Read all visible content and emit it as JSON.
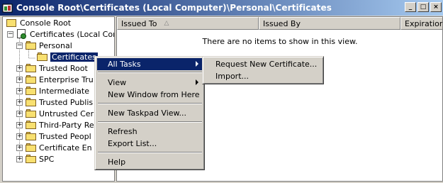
{
  "window": {
    "title": "Console Root\\Certificates (Local Computer)\\Personal\\Certificates",
    "buttons": [
      "_",
      "□",
      "×"
    ]
  },
  "tree": {
    "items": [
      {
        "label": "Console Root",
        "icon": "console-root-icon"
      },
      {
        "label": "Certificates (Local Com",
        "icon": "certificate-snapin-icon",
        "expander": "−"
      },
      {
        "label": "Personal",
        "icon": "folder-icon",
        "expander": "−"
      },
      {
        "label": "Certificates",
        "icon": "folder-open-icon"
      },
      {
        "label": "Trusted Root",
        "icon": "folder-icon",
        "expander": "+"
      },
      {
        "label": "Enterprise Tru",
        "icon": "folder-icon",
        "expander": "+"
      },
      {
        "label": "Intermediate",
        "icon": "folder-icon",
        "expander": "+"
      },
      {
        "label": "Trusted Publis",
        "icon": "folder-icon",
        "expander": "+"
      },
      {
        "label": "Untrusted Cer",
        "icon": "folder-icon",
        "expander": "+"
      },
      {
        "label": "Third-Party Re",
        "icon": "folder-icon",
        "expander": "+"
      },
      {
        "label": "Trusted Peopl",
        "icon": "folder-icon",
        "expander": "+"
      },
      {
        "label": "Certificate En",
        "icon": "folder-icon",
        "expander": "+"
      },
      {
        "label": "SPC",
        "icon": "folder-icon",
        "expander": "+"
      }
    ]
  },
  "list": {
    "columns": [
      "Issued To",
      "Issued By",
      "Expiration D"
    ],
    "sort_indicator": "△",
    "empty_message": "There are no items to show in this view."
  },
  "context_menu": {
    "items": [
      "All Tasks",
      "View",
      "New Window from Here",
      "New Taskpad View...",
      "Refresh",
      "Export List...",
      "Help"
    ]
  },
  "submenu": {
    "items": [
      "Request New Certificate...",
      "Import..."
    ]
  },
  "colors": {
    "title_start": "#0a246a",
    "title_end": "#a6caf0",
    "highlight": "#0a246a",
    "face": "#d4d0c8"
  }
}
